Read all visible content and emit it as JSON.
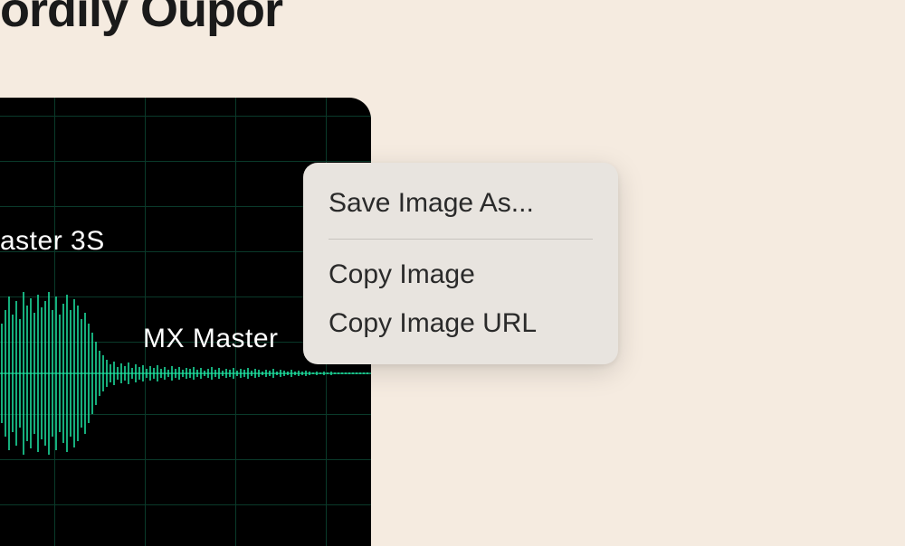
{
  "heading": "ordily Oupor",
  "waveform": {
    "label1": "aster 3S",
    "label2": "MX Master",
    "color": "#1ee8a5"
  },
  "contextMenu": {
    "items": [
      {
        "label": "Save Image As...",
        "hasDivider": true
      },
      {
        "label": "Copy Image",
        "hasDivider": false
      },
      {
        "label": "Copy Image URL",
        "hasDivider": false
      }
    ]
  }
}
